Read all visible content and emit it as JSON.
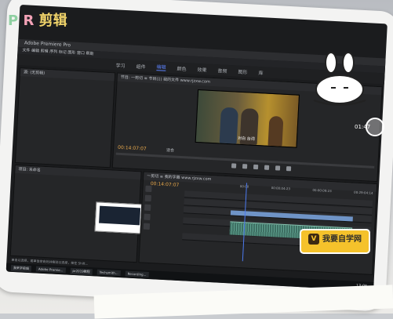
{
  "overlay": {
    "brand_p": "P",
    "brand_r": "R",
    "brand_cn": "剪辑",
    "rec_time": "01:47",
    "badge_letter": "V",
    "badge_text": "我要自学网"
  },
  "app": {
    "title": "Adobe Premiere Pro",
    "menu": "文件  编辑  剪辑  序列  标记  图形  窗口  帮助",
    "workspaces": [
      "学习",
      "组件",
      "编辑",
      "颜色",
      "效果",
      "音频",
      "图形",
      "库"
    ],
    "active_workspace": "编辑"
  },
  "panels": {
    "source_title": "源: (无剪辑)",
    "program_title": "节目: 一剪切 ≡ 节目(1) 我的文件 www.rjzxw.com",
    "project_title": "项目: 未命名",
    "timeline_title": "一剪切 ≡ 我的字幕 www.rjzxw.com",
    "program_timecode": "00:14:07:07",
    "timeline_timecode": "00:14:07:07",
    "fit_label": "适合",
    "subtitle_text": "对白 台词"
  },
  "ruler_ticks": [
    "00:00",
    "00:00:04:23",
    "00:00:09:23",
    "00:29:04:14"
  ],
  "taskbar": {
    "items": [
      "我来学剪辑",
      "Adobe Premie...",
      "pr2019教程",
      "Techsmith...",
      "Recording..."
    ],
    "status": "单击以选择，或单击空白处并拖动以选择，按住 Shift...",
    "clock": "13:05"
  }
}
